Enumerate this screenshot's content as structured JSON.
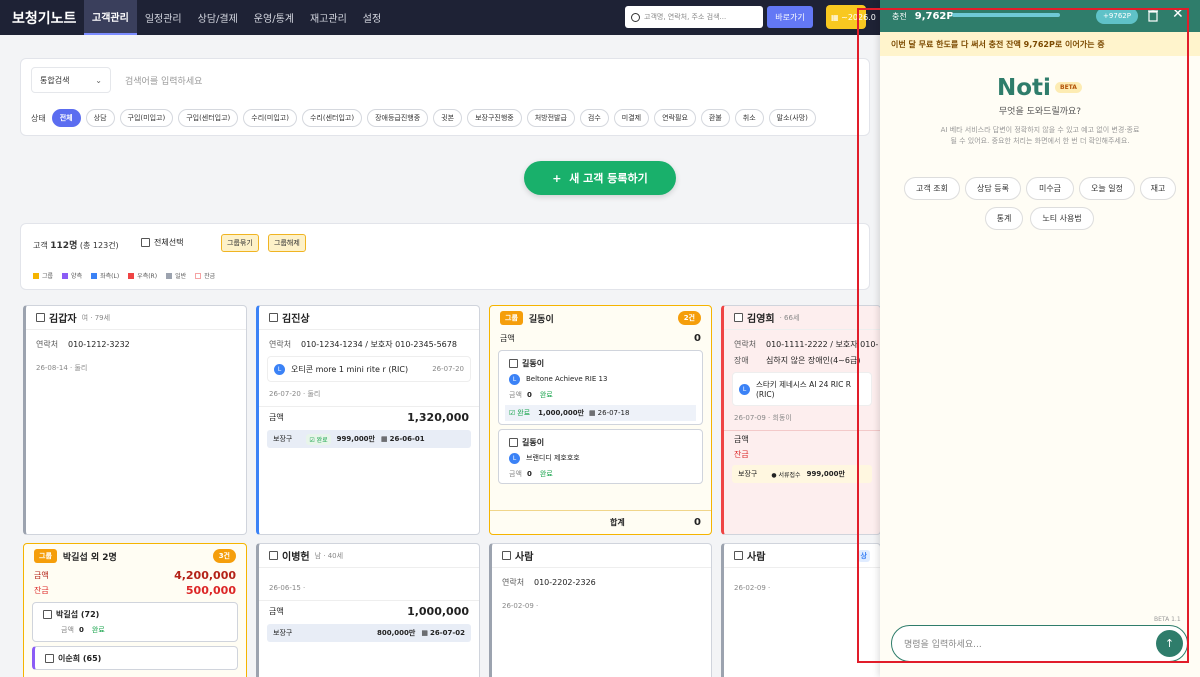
{
  "app": {
    "logo": "보청기노트",
    "nav": [
      "고객관리",
      "일정관리",
      "상담/결제",
      "운영/통계",
      "재고관리",
      "설정"
    ],
    "search_placeholder": "고객명, 연락처, 주소 검색...",
    "goto": "바로가기",
    "yellow_text": "~2026.0"
  },
  "filter": {
    "search_type": "통합검색",
    "search_placeholder": "검색어를 입력하세요",
    "status_label": "상태",
    "chips": [
      "전체",
      "상담",
      "구입(미입고)",
      "구입(센터입고)",
      "수리(미입고)",
      "수리(센터입고)",
      "장애등급진행중",
      "귓본",
      "보장구진행중",
      "처방전발급",
      "검수",
      "미결제",
      "연락필요",
      "환불",
      "취소",
      "말소(사망)"
    ]
  },
  "new_customer": "새 고객 등록하기",
  "summary": {
    "label": "고객",
    "count": "112명",
    "total": "(총 123건)",
    "select_all": "전체선택",
    "group_bind": "그룹묶기",
    "group_unbind": "그룹해제",
    "legend": [
      {
        "label": "그룹",
        "color": "#f5b400"
      },
      {
        "label": "양측",
        "color": "#8b5cf6"
      },
      {
        "label": "좌측(L)",
        "color": "#3b82f6"
      },
      {
        "label": "우측(R)",
        "color": "#ef4444"
      },
      {
        "label": "일반",
        "color": "#9ca3af"
      },
      {
        "label": "잔금",
        "color": "#fbd5d5"
      }
    ]
  },
  "cards": {
    "c1": {
      "name": "김갑자",
      "sub": "여 · 79세",
      "phone_k": "연락처",
      "phone": "010-1212-3232",
      "date": "26-08-14 · 둘리"
    },
    "c2": {
      "name": "김진상",
      "phone_k": "연락처",
      "phone": "010-1234-1234 / 보호자 010-2345-5678",
      "prod": "오티콘 more 1 mini rite r (RIC)",
      "prod_date": "26-07-20",
      "date": "26-07-20 · 둘리",
      "amt_k": "금액",
      "amt": "1,320,000",
      "bjg_k": "보장구",
      "bjg_tag": "완료",
      "bjg_amt": "999,000만",
      "bjg_date": "26-06-01"
    },
    "c3": {
      "badge": "그룹",
      "name": "길동이",
      "cnt": "2건",
      "amt_k": "금액",
      "amt": "0",
      "s1": {
        "name": "길동이",
        "prod": "Beltone Achieve RIE 13",
        "amt_k": "금액",
        "amt": "0",
        "status": "완료",
        "tag": "완료",
        "tag_amt": "1,000,000만",
        "tag_date": "26-07-18"
      },
      "s2": {
        "name": "길동이",
        "prod": "브랜디디 제호호호",
        "amt_k": "금액",
        "amt": "0",
        "status": "완료"
      },
      "total_k": "합계",
      "total": "0"
    },
    "c4": {
      "name": "김영희",
      "sub": "· 66세",
      "phone_k": "연락처",
      "phone": "010-1111-2222 / 보호자 010-",
      "dis_k": "장애",
      "dis": "심하지 않은 장애인(4~6급)",
      "prod": "스타키 제네시스 AI 24 RIC R (RIC)",
      "date": "26-07-09 · 희동이",
      "amt_k": "금액",
      "rem_k": "잔금",
      "bjg_k": "보장구",
      "bjg_tag": "서류접수",
      "bjg_amt": "999,000만"
    },
    "c5": {
      "badge": "그룹",
      "name": "박길섭 외 2명",
      "cnt": "3건",
      "amt_k": "금액",
      "amt": "4,200,000",
      "rem_k": "잔금",
      "rem": "500,000",
      "s1": "박길섭 (72)",
      "s1_amt_k": "금액",
      "s1_amt": "0",
      "s1_status": "완료",
      "s2": "이순희 (65)"
    },
    "c6": {
      "name": "이병헌",
      "sub": "남 · 40세",
      "date": "26-06-15 ·",
      "amt_k": "금액",
      "amt": "1,000,000",
      "bjg_k": "보장구",
      "bjg_amt": "800,000만",
      "bjg_date": "26-07-02"
    },
    "c7": {
      "name": "사람",
      "phone_k": "연락처",
      "phone": "010-2202-2326",
      "date": "26-02-09 ·"
    },
    "c8": {
      "name": "사람",
      "date": "26-02-09 ·",
      "tag": "상"
    }
  },
  "noti": {
    "charge_label": "충전",
    "points": "9,762P",
    "pill": "+9762P",
    "banner": "이번 달 무료 한도를 다 써서 충전 잔액 9,762P로 이어가는 중",
    "title": "Noti",
    "beta": "BETA",
    "question": "무엇을 도와드릴까요?",
    "desc": "AI 베타 서비스라 답변이 정확하지 않을 수 있고 예고 없이 변경·종료될 수 있어요. 중요한 처리는 화면에서 한 번 더 확인해주세요.",
    "quick": [
      "고객 조회",
      "상담 등록",
      "미수금",
      "오늘 일정",
      "재고",
      "통계",
      "노티 사용법"
    ],
    "version": "BETA 1.1",
    "input_placeholder": "명령을 입력하세요...",
    "send": "↑"
  }
}
